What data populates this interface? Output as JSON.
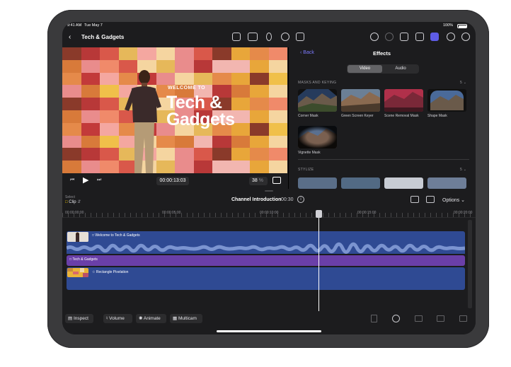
{
  "status": {
    "time": "9:41 AM",
    "date": "Tue May 7",
    "battery": "100%"
  },
  "header": {
    "title": "Tech & Gadgets"
  },
  "viewer": {
    "welcome": "WELCOME TO",
    "title_line1": "Tech &",
    "title_line2": "Gadgets",
    "timecode": "00:00:13:03",
    "zoom": "38",
    "zoom_unit": "%"
  },
  "effects": {
    "back": "Back",
    "title": "Effects",
    "tabs": [
      "Video",
      "Audio"
    ],
    "section1": "MASKS AND KEYING",
    "section1_count": "5",
    "items": [
      "Corner Mask",
      "Green Screen Keyer",
      "Scene Removal Mask",
      "Shape Mask",
      "Vignette Mask"
    ],
    "section2": "STYLIZE",
    "section2_count": "5"
  },
  "timeline": {
    "select_label": "Select",
    "select_value": "Clip",
    "project": "Channel Introduction",
    "duration": "00:30",
    "options": "Options",
    "ruler": [
      "00:00:00:00",
      "00:00:05:00",
      "00:00:10:00",
      "00:00:15:00",
      "00:00:20:00"
    ],
    "clips": {
      "main": "Welcome to Tech & Gadgets",
      "title": "Tech & Gadgets",
      "rect": "Rectangle Pixelation"
    }
  },
  "bottom": {
    "inspect": "Inspect",
    "volume": "Volume",
    "animate": "Animate",
    "multicam": "Multicam"
  },
  "colors": {
    "accent": "#5e5ce6",
    "clip_blue": "#2f4a93",
    "clip_purple": "#6a3fa8"
  }
}
